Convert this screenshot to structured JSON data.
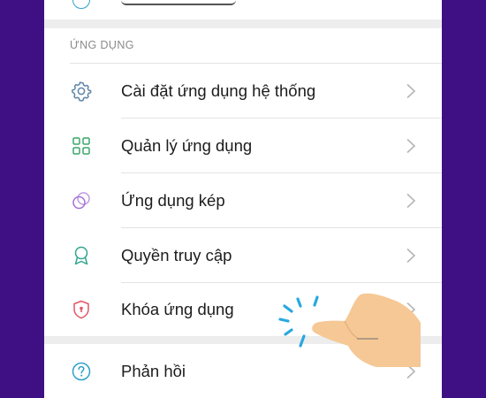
{
  "section": {
    "title": "ỨNG DỤNG"
  },
  "rows": [
    {
      "label": "Cài đặt ứng dụng hệ thống",
      "icon": "gear-icon",
      "icon_color": "#5f86a6"
    },
    {
      "label": "Quản lý ứng dụng",
      "icon": "app-grid-icon",
      "icon_color": "#3aa56a"
    },
    {
      "label": "Ứng dụng kép",
      "icon": "dual-circle-icon",
      "icon_color": "#a46fd6"
    },
    {
      "label": "Quyền truy cập",
      "icon": "badge-icon",
      "icon_color": "#32a58e"
    },
    {
      "label": "Khóa ứng dụng",
      "icon": "shield-lock-icon",
      "icon_color": "#e15767"
    }
  ],
  "feedback": {
    "label": "Phản hồi",
    "icon": "help-circle-icon",
    "icon_color": "#2ea0c9"
  },
  "colors": {
    "background": "#3f1083",
    "screen": "#ededed",
    "chevron": "#b5b5b5",
    "tap_rays": "#29a8e0",
    "hand": "#f5c896"
  }
}
